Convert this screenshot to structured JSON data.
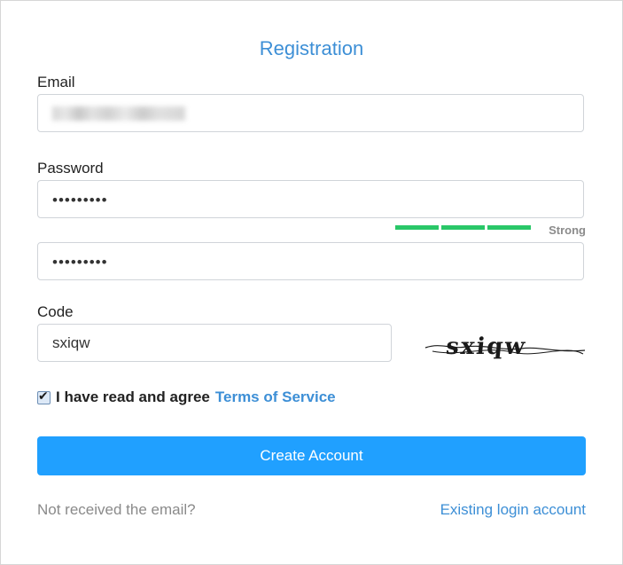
{
  "form": {
    "title": "Registration",
    "email": {
      "label": "Email",
      "value": ""
    },
    "password": {
      "label": "Password",
      "masked_value": "•••••••••",
      "strength": {
        "label": "Strong",
        "level": 3,
        "max_level": 3,
        "color": "#29c768"
      }
    },
    "confirm_password": {
      "masked_value": "•••••••••"
    },
    "code": {
      "label": "Code",
      "value": "sxiqw",
      "captcha_text": "sxiqw"
    },
    "agreement": {
      "checked": true,
      "text": "I have read and agree",
      "link_text": "Terms of Service"
    },
    "submit_label": "Create Account",
    "footer": {
      "resend_text": "Not received the email?",
      "login_link": "Existing login account"
    }
  },
  "colors": {
    "accent": "#3d8fd6",
    "button": "#20a0ff",
    "muted": "#8a8a8a"
  }
}
